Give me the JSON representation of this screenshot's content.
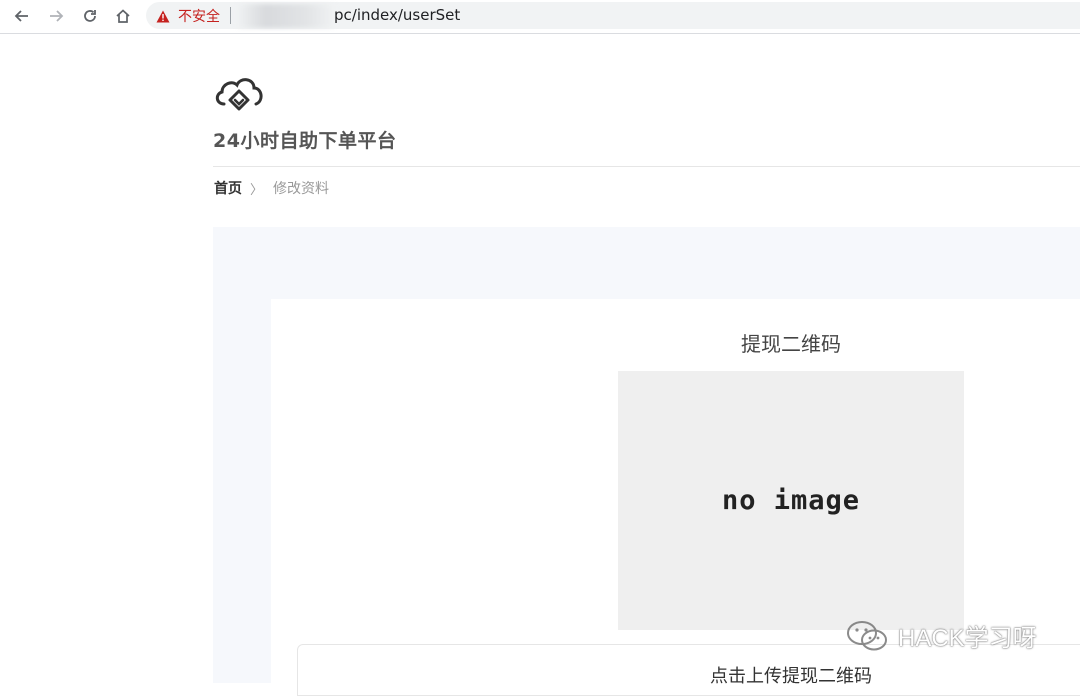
{
  "browser": {
    "security_label": "不安全",
    "url_visible": "pc/index/userSet"
  },
  "site": {
    "title": "24小时自助下单平台"
  },
  "breadcrumb": {
    "home": "首页",
    "separator": "〉",
    "current": "修改资料"
  },
  "qr_section": {
    "title": "提现二维码",
    "placeholder_text": "no image",
    "upload_label": "点击上传提现二维码"
  },
  "watermark": {
    "text": "HACK学习呀"
  },
  "colors": {
    "warning": "#c5221f",
    "content_bg": "#f6f8fc",
    "image_bg": "#efefef"
  },
  "icons": {
    "back": "arrow-left-icon",
    "forward": "arrow-right-icon",
    "reload": "reload-icon",
    "home": "home-icon",
    "warning": "warning-triangle-icon",
    "logo": "cloud-logo-icon",
    "watermark": "wechat-icon"
  }
}
